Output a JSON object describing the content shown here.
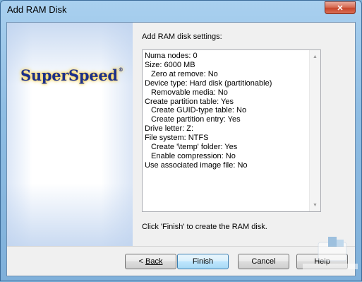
{
  "window": {
    "title": "Add RAM Disk",
    "close_glyph": "✕"
  },
  "side_panel": {
    "logo_text": "SuperSpeed",
    "logo_mark": "®"
  },
  "main": {
    "settings_label": "Add RAM disk settings:",
    "settings": [
      "Numa nodes: 0",
      "Size: 6000 MB",
      "   Zero at remove: No",
      "Device type: Hard disk (partitionable)",
      "   Removable media: No",
      "Create partition table: Yes",
      "   Create GUID-type table: No",
      "   Create partition entry: Yes",
      "Drive letter: Z:",
      "File system: NTFS",
      "   Create '\\temp' folder: Yes",
      "   Enable compression: No",
      "Use associated image file: No"
    ],
    "finish_note": "Click 'Finish' to create the RAM disk.",
    "scroll_up": "▲",
    "scroll_down": "▼"
  },
  "buttons": {
    "back_prefix": "< ",
    "back_label": "Back",
    "finish_label": "Finish",
    "cancel_label": "Cancel",
    "help_label": "Help"
  }
}
